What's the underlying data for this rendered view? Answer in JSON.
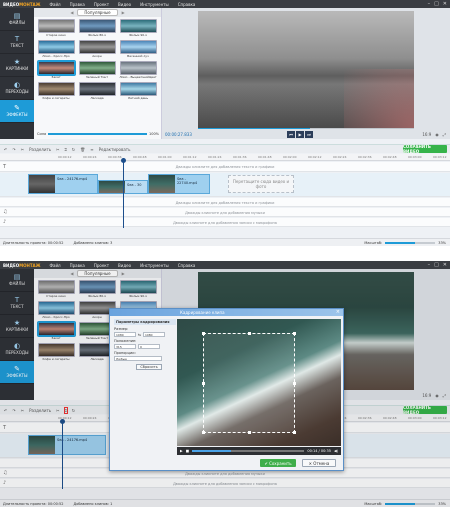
{
  "menu": {
    "logo_prefix": "ВИДЕО",
    "logo_suffix": "МОНТАЖ",
    "items": [
      "Файл",
      "Правка",
      "Проект",
      "Видео",
      "Инструменты",
      "Справка"
    ],
    "window_controls": [
      "–",
      "□",
      "✕"
    ]
  },
  "sidebar": {
    "items": [
      {
        "label": "ФАЙЛЫ",
        "icon": "folder-icon"
      },
      {
        "label": "ТЕКСТ",
        "icon": "text-icon"
      },
      {
        "label": "КАРТИНКИ",
        "icon": "star-icon"
      },
      {
        "label": "ПЕРЕХОДЫ",
        "icon": "transitions-icon"
      },
      {
        "label": "ЭФФЕКТЫ",
        "icon": "effects-icon"
      }
    ],
    "active_index": 4
  },
  "library": {
    "category": "Популярные",
    "prev_glyph": "◀",
    "next_glyph": "▶",
    "effects": [
      {
        "name": "Старое кино",
        "tone": "gray"
      },
      {
        "name": "Фильм 80-х",
        "tone": "blue"
      },
      {
        "name": "Фильм 90-х",
        "tone": "teal"
      },
      {
        "name": "Ломо - Кросс-Про",
        "tone": "cyan"
      },
      {
        "name": "Акорн",
        "tone": "mono"
      },
      {
        "name": "Весенний луч",
        "tone": "sky"
      },
      {
        "name": "Закат",
        "tone": "sunset"
      },
      {
        "name": "Зеленый Тинт",
        "tone": "green"
      },
      {
        "name": "Ломо - ВыцветшийЦвет",
        "tone": "faded"
      },
      {
        "name": "Кофе и сигареты",
        "tone": "coffee"
      },
      {
        "name": "Ласкада",
        "tone": "dark"
      },
      {
        "name": "Летний день",
        "tone": "summer"
      }
    ],
    "selected_index": 6,
    "speed_label": "Сила",
    "speed_value": "100%",
    "speed_fraction": 1.0
  },
  "preview": {
    "time": "00:00:27.833",
    "aspect": "16:9",
    "controls": [
      "⏮",
      "▶",
      "⏭"
    ],
    "seek_fraction": 0.52
  },
  "toolbar": {
    "undo": "↶",
    "redo": "↷",
    "split_label": "Разделить",
    "edit_label": "Редактировать",
    "save_label": "СОХРАНИТЬ ВИДЕО"
  },
  "ruler": {
    "ticks": [
      "00:00:12",
      "00:00:24",
      "00:00:36",
      "00:00:48",
      "00:01:00",
      "00:01:12",
      "00:01:24",
      "00:01:36",
      "00:01:48",
      "00:02:00",
      "00:02:12",
      "00:02:24",
      "00:02:36",
      "00:02:48",
      "00:03:00",
      "00:03:12",
      "00:03:24"
    ]
  },
  "timeline": {
    "text_hint": "Дважды кликните для добавления текста и графики",
    "clips_top": [
      "Sea - 24176.mp4",
      "Sea - 30",
      "Sea - 22740.mp4"
    ],
    "clips_bottom": [
      "Sea - 24176.mp4"
    ],
    "drop_hint": "Перетащите сюда видео и фото",
    "music_hint": "Дважды кликните для добавления музыки",
    "voice_hint": "Дважды кликните для добавления записи с микрофона"
  },
  "status": {
    "duration_label": "Длительность проекта:",
    "duration_value": "00:00:52",
    "clips_label": "Добавлено клипов:",
    "clips_value_top": "3",
    "clips_value_bottom": "1",
    "zoom_label": "Масштаб:",
    "zoom_value": "33%",
    "zoom_fraction": 0.6
  },
  "dialog": {
    "title": "Кадрирование клипа",
    "params_header": "Параметры кадрирования",
    "size_label": "Размер:",
    "width": "1080",
    "height": "1080",
    "position_label": "Положение:",
    "pos_x": "315",
    "pos_y": "0",
    "proportions_label": "Пропорции:",
    "proportions_value": "Любые",
    "reset_label": "Сбросить",
    "time": "00:14 / 00:35",
    "save_label": "Сохранить",
    "cancel_label": "Отмена"
  }
}
